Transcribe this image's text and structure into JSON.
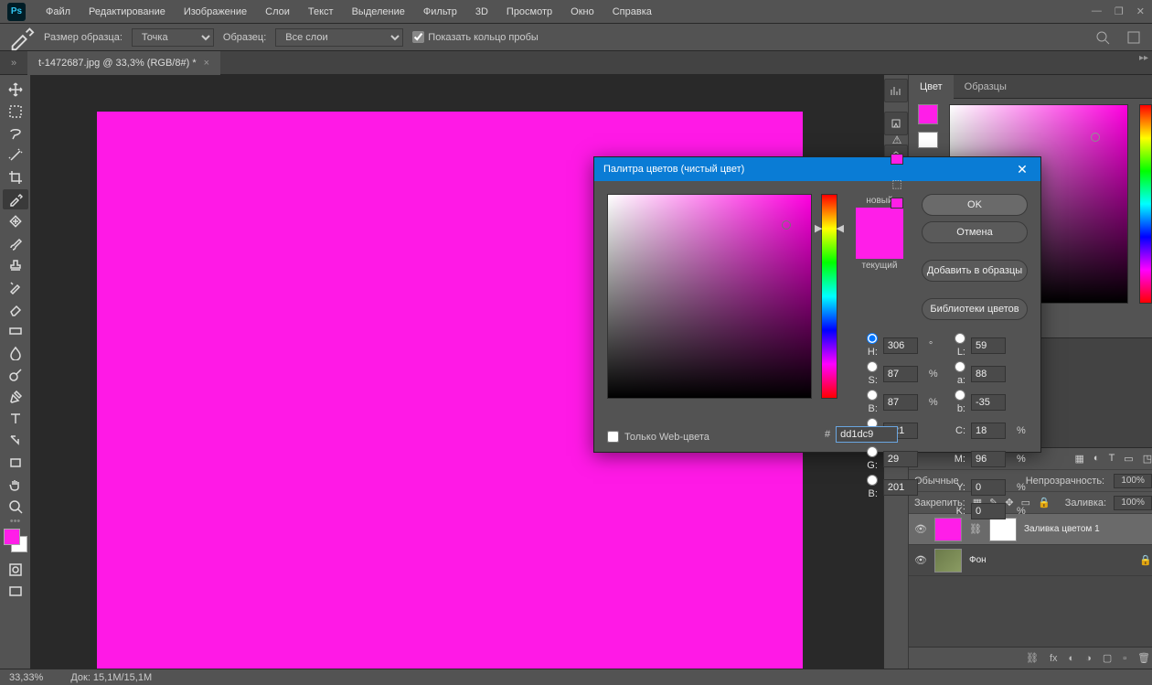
{
  "menu": {
    "items": [
      "Файл",
      "Редактирование",
      "Изображение",
      "Слои",
      "Текст",
      "Выделение",
      "Фильтр",
      "3D",
      "Просмотр",
      "Окно",
      "Справка"
    ]
  },
  "options": {
    "sample_label": "Размер образца:",
    "sample_value": "Точка",
    "sample_target_label": "Образец:",
    "sample_target_value": "Все слои",
    "show_ring": "Показать кольцо пробы"
  },
  "document": {
    "tab": "t-1472687.jpg @ 33,3% (RGB/8#) *"
  },
  "color_tabs": {
    "color": "Цвет",
    "swatches": "Образцы"
  },
  "layers": {
    "opacity_label": "Непрозрачность:",
    "opacity": "100%",
    "fill_label": "Заливка:",
    "fill": "100%",
    "lock_label": "Закрепить:",
    "normal": "Обычные",
    "items": [
      {
        "name": "Заливка цветом 1"
      },
      {
        "name": "Фон"
      }
    ]
  },
  "status": {
    "zoom": "33,33%",
    "doc": "Док: 15,1M/15,1M"
  },
  "picker": {
    "title": "Палитра цветов (чистый цвет)",
    "new": "новый",
    "current": "текущий",
    "ok": "OK",
    "cancel": "Отмена",
    "add": "Добавить в образцы",
    "libs": "Библиотеки цветов",
    "H": "306",
    "S": "87",
    "B": "87",
    "R": "221",
    "G": "29",
    "Bl": "201",
    "L": "59",
    "a": "88",
    "b": "-35",
    "C": "18",
    "M": "96",
    "Y": "0",
    "K": "0",
    "hex": "dd1dc9",
    "web_only": "Только Web-цвета"
  }
}
